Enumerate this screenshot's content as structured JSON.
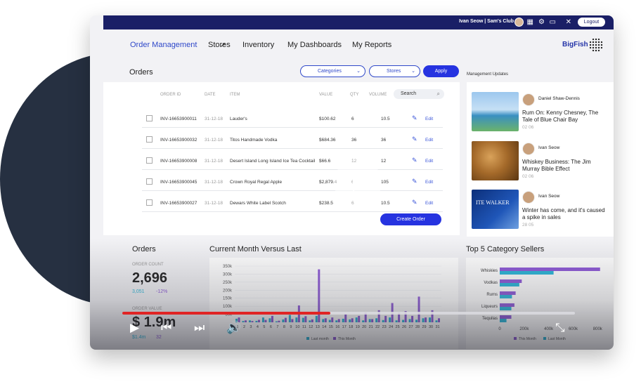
{
  "topbar": {
    "user_label": "Ivan Seow | Sam's Club",
    "logout_label": "Logout",
    "icons": [
      "grid-icon",
      "gear-icon",
      "folder-icon",
      "tools-icon"
    ]
  },
  "nav": {
    "items": [
      "Order Management",
      "Stores",
      "Inventory",
      "My Dashboards",
      "My Reports"
    ],
    "active": "Order Management",
    "brand": "BigFish"
  },
  "orders": {
    "title": "Orders",
    "filters": {
      "categories": "Categories",
      "stores": "Stores",
      "apply": "Apply"
    },
    "columns": [
      "ORDER ID",
      "DATE",
      "ITEM",
      "VALUE",
      "QTY",
      "VOLUME"
    ],
    "search_placeholder": "Search",
    "rows": [
      {
        "id": "INV-16653900011",
        "date": "31-12-18",
        "item": "Lauder's",
        "value": "$100.62",
        "qty": "6",
        "volume": "10.5",
        "edit": "Edit"
      },
      {
        "id": "INV-16653900032",
        "date": "31-12-18",
        "item": "Titos Handmade Vodka",
        "value": "$684.36",
        "qty": "36",
        "volume": "36",
        "edit": "Edit"
      },
      {
        "id": "INV-16653900008",
        "date": "31-12-18",
        "item": "Desert Island Long Island Ice Tea Cocktail",
        "value": "$66.6",
        "qty": "12",
        "volume": "12",
        "edit": "Edit"
      },
      {
        "id": "INV-16653900045",
        "date": "31-12-18",
        "item": "Crown Royal Regal Apple",
        "value": "$2,879.4",
        "qty": "60",
        "volume": "105",
        "edit": "Edit"
      },
      {
        "id": "INV-16653900027",
        "date": "31-12-18",
        "item": "Dewars White Label Scotch",
        "value": "$238.5",
        "qty": "6",
        "volume": "10.5",
        "edit": "Edit"
      }
    ],
    "create_label": "Create Order"
  },
  "updates": {
    "title": "Management Updates",
    "items": [
      {
        "author": "Daniel Shaw-Dennis",
        "headline": "Rum On: Kenny Chesney, The Tale of Blue Chair Bay",
        "date": "02 06"
      },
      {
        "author": "Ivan Seow",
        "headline": "Whiskey Business: The Jim Murray Bible Effect",
        "date": "02 06"
      },
      {
        "author": "Ivan Seow",
        "headline": "Winter has come, and it's caused a spike in sales",
        "date": "28 05"
      }
    ],
    "image_text": "ITE WALKER"
  },
  "stats": {
    "title": "Orders",
    "count_label": "ORDER COUNT",
    "count": "2,696",
    "count_sub": "3,051",
    "count_change": "-12%",
    "value_label": "ORDER VALUE",
    "value": "$ 1.9m",
    "value_sub": "$1.4m",
    "value_change": "32"
  },
  "month_chart": {
    "title": "Current Month Versus Last",
    "legend": [
      "Last month",
      "This Month"
    ],
    "chart_data": {
      "type": "bar",
      "categories": [
        "1",
        "2",
        "3",
        "4",
        "5",
        "6",
        "7",
        "8",
        "9",
        "10",
        "11",
        "12",
        "13",
        "14",
        "15",
        "16",
        "17",
        "18",
        "19",
        "20",
        "21",
        "22",
        "23",
        "24",
        "25",
        "26",
        "27",
        "28",
        "29",
        "30",
        "31"
      ],
      "series": [
        {
          "name": "Last month",
          "values": [
            22,
            8,
            12,
            9,
            30,
            25,
            6,
            18,
            46,
            30,
            28,
            12,
            40,
            20,
            15,
            12,
            22,
            18,
            30,
            12,
            20,
            25,
            14,
            30,
            12,
            15,
            20,
            16,
            25,
            30,
            12
          ]
        },
        {
          "name": "This Month",
          "values": [
            30,
            12,
            8,
            15,
            15,
            40,
            10,
            28,
            20,
            105,
            38,
            18,
            330,
            25,
            30,
            20,
            50,
            25,
            40,
            60,
            20,
            75,
            40,
            120,
            60,
            70,
            40,
            160,
            30,
            75,
            25
          ]
        }
      ],
      "ylabel_ticks": [
        "350k",
        "300k",
        "250k",
        "200k",
        "150k",
        "100k",
        "50k"
      ],
      "ylim": [
        0,
        350
      ]
    },
    "colors": {
      "last": "#2bb7d9",
      "this": "#8f5bd8"
    }
  },
  "category_chart": {
    "title": "Top 5 Category Sellers",
    "legend": [
      "This Month",
      "Last Month"
    ],
    "chart_data": {
      "type": "bar",
      "categories": [
        "Whiskies",
        "Vodkas",
        "Rums",
        "Liqueurs",
        "Tequilas"
      ],
      "series": [
        {
          "name": "This Month",
          "values": [
            820,
            180,
            130,
            120,
            95
          ]
        },
        {
          "name": "Last Month",
          "values": [
            440,
            160,
            100,
            95,
            55
          ]
        }
      ],
      "x_ticks": [
        "0",
        "200k",
        "400k",
        "600k",
        "800k"
      ],
      "xlim": [
        0,
        850
      ]
    }
  },
  "player": {
    "progress_fraction": 0.46
  }
}
